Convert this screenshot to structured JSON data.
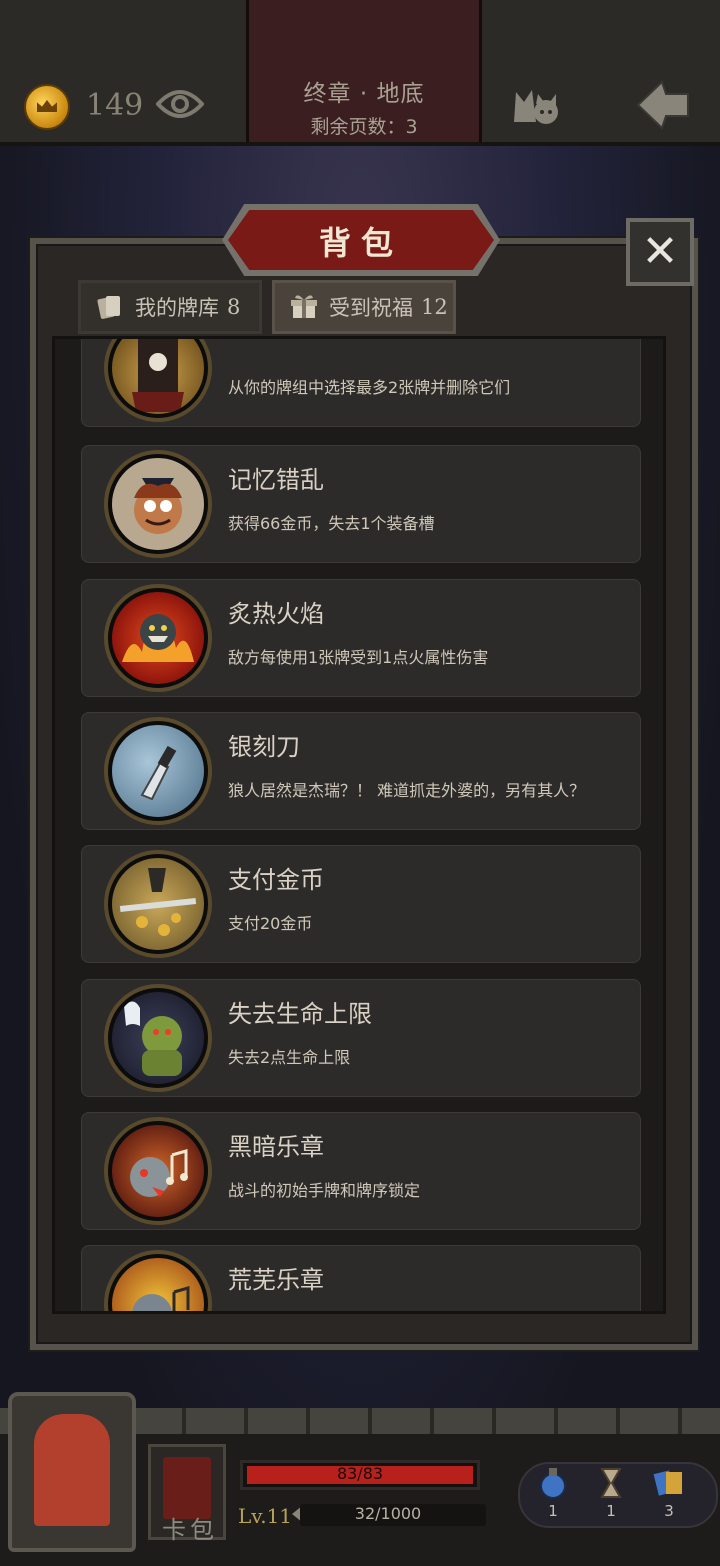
{
  "header": {
    "gold": "149",
    "chapter_title": "终章 · 地底",
    "pages_left": "剩余页数：3"
  },
  "panel": {
    "title": "背包",
    "close": "✕",
    "tabs": [
      {
        "label": "我的牌库",
        "count": "8"
      },
      {
        "label": "受到祝福",
        "count": "12"
      }
    ]
  },
  "items": [
    {
      "name": "",
      "desc": "从你的牌组中选择最多2张牌并删除它们",
      "icon": "pirate-skull-icon"
    },
    {
      "name": "记忆错乱",
      "desc": "获得66金币，失去1个装备槽",
      "icon": "crazy-man-icon"
    },
    {
      "name": "炙热火焰",
      "desc": "敌方每使用1张牌受到1点火属性伤害",
      "icon": "fire-monster-icon"
    },
    {
      "name": "银刻刀",
      "desc": "狼人居然是杰瑞？！ 难道抓走外婆的，另有其人？",
      "icon": "silver-knife-icon"
    },
    {
      "name": "支付金币",
      "desc": "支付20金币",
      "icon": "gold-sword-icon"
    },
    {
      "name": "失去生命上限",
      "desc": "失去2点生命上限",
      "icon": "ghost-orc-icon"
    },
    {
      "name": "黑暗乐章",
      "desc": "战斗的初始手牌和牌序锁定",
      "icon": "dark-music-icon"
    },
    {
      "name": "荒芜乐章",
      "desc": "",
      "icon": "barren-music-icon"
    }
  ],
  "bottom": {
    "card_label": "卡包",
    "hp_text": "83/83",
    "hp_fraction": 1.0,
    "level": "Lv.11",
    "xp_text": "32/1000",
    "consumables": [
      {
        "icon": "potion-icon",
        "count": "1"
      },
      {
        "icon": "hourglass-icon",
        "count": "1"
      },
      {
        "icon": "cards-icon",
        "count": "3"
      }
    ]
  }
}
